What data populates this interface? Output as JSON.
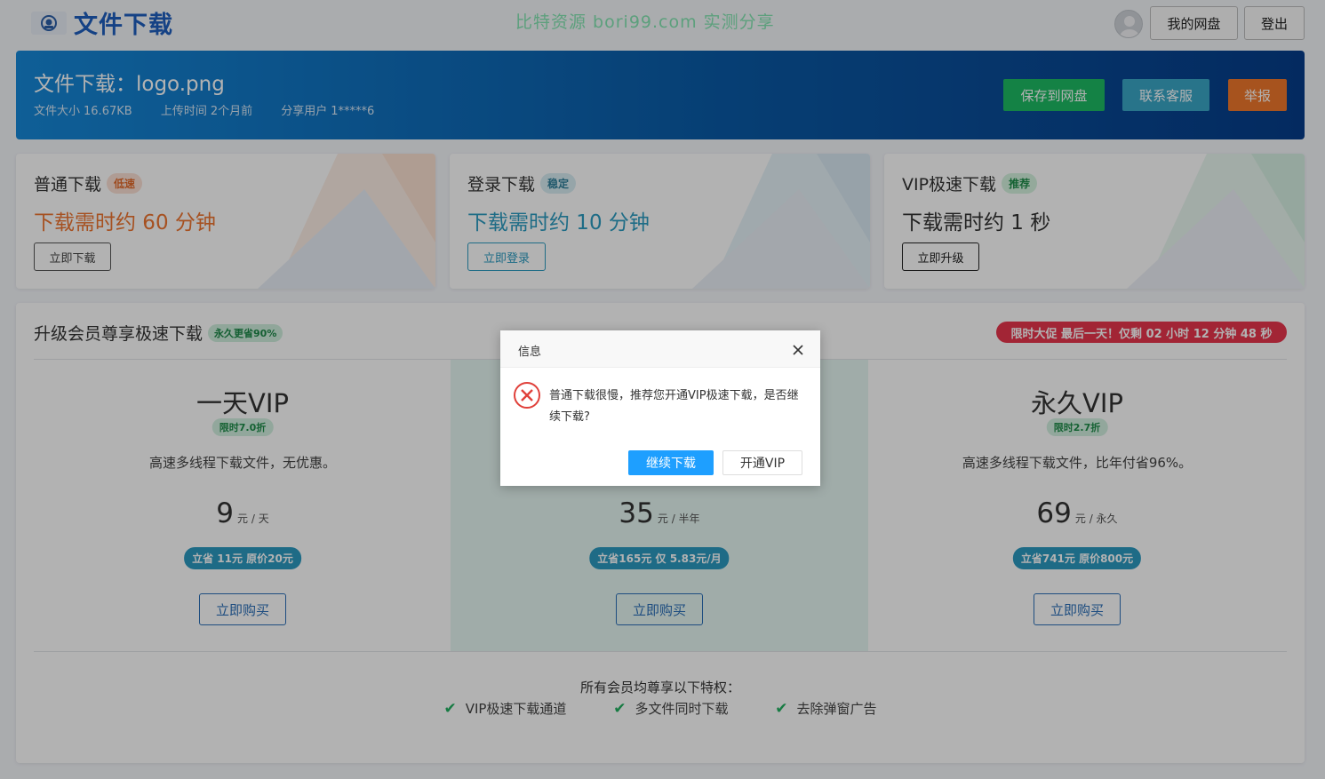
{
  "header": {
    "site_title": "文件下载",
    "watermark": "比特资源 bori99.com 实测分享",
    "my_drive_label": "我的网盘",
    "logout_label": "登出"
  },
  "file": {
    "title": "文件下载：logo.png",
    "size_label": "文件大小",
    "size_value": "16.67KB",
    "upload_label": "上传时间",
    "upload_value": "2个月前",
    "sharer_label": "分享用户",
    "sharer_value": "1*****6",
    "actions": {
      "save": "保存到网盘",
      "service": "联系客服",
      "report": "举报"
    },
    "colors": {
      "save": "#1dbb63",
      "service": "#3aa6c6",
      "report": "#f0782c"
    }
  },
  "download_options": [
    {
      "name": "普通下载",
      "badge": "低速",
      "time": "下载需时约 60 分钟",
      "button": "立即下载"
    },
    {
      "name": "登录下载",
      "badge": "稳定",
      "time": "下载需时约 10 分钟",
      "button": "立即登录"
    },
    {
      "name": "VIP极速下载",
      "badge": "推荐",
      "time": "下载需时约 1 秒",
      "button": "立即升级"
    }
  ],
  "vip": {
    "title": "升级会员尊享极速下载",
    "title_badge": "永久更省90%",
    "promo": "限时大促 最后一天！仅剩 02 小时 12 分钟 48 秒",
    "plans": [
      {
        "name": "一天VIP",
        "discount": "限时7.0折",
        "desc": "高速多线程下载文件，无优惠。",
        "price": "9",
        "unit": "元 / 天",
        "save": "立省 11元 原价20元",
        "button": "立即购买"
      },
      {
        "name": "",
        "discount": "",
        "desc": "",
        "price": "35",
        "unit": "元 / 半年",
        "save": "立省165元 仅 5.83元/月",
        "button": "立即购买"
      },
      {
        "name": "永久VIP",
        "discount": "限时2.7折",
        "desc": "高速多线程下载文件，比年付省96%。",
        "price": "69",
        "unit": "元 / 永久",
        "save": "立省741元 原价800元",
        "button": "立即购买"
      }
    ],
    "perks_title": "所有会员均尊享以下特权：",
    "perks": [
      "VIP极速下载通道",
      "多文件同时下载",
      "去除弹窗广告"
    ]
  },
  "dialog": {
    "title": "信息",
    "message": "普通下载很慢，推荐您开通VIP极速下载，是否继续下载?",
    "continue_label": "继续下载",
    "vip_label": "开通VIP",
    "icon": "error-icon",
    "accent": "#1e9fff"
  }
}
